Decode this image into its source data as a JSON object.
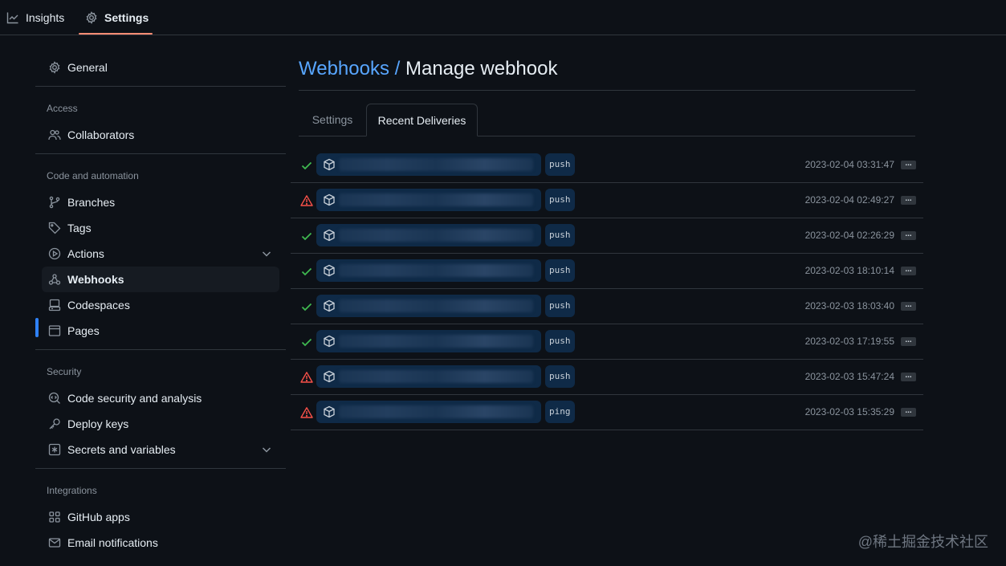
{
  "nav": {
    "tabs": [
      {
        "label": "Insights",
        "icon": "graph-icon"
      },
      {
        "label": "Settings",
        "icon": "gear-icon",
        "active": true
      }
    ],
    "accent": "#fd8c73"
  },
  "sidebar": {
    "general": "General",
    "sections": [
      {
        "heading": "Access",
        "items": [
          "Collaborators"
        ]
      },
      {
        "heading": "Code and automation",
        "items": [
          "Branches",
          "Tags",
          "Actions",
          "Webhooks",
          "Codespaces",
          "Pages"
        ]
      },
      {
        "heading": "Security",
        "items": [
          "Code security and analysis",
          "Deploy keys",
          "Secrets and variables"
        ]
      },
      {
        "heading": "Integrations",
        "items": [
          "GitHub apps",
          "Email notifications"
        ]
      }
    ],
    "active_item": "Webhooks"
  },
  "main": {
    "breadcrumb": "Webhooks",
    "separator": " / ",
    "title": "Manage webhook",
    "tabs": [
      "Settings",
      "Recent Deliveries"
    ],
    "active_tab": "Recent Deliveries"
  },
  "deliveries": [
    {
      "status": "success",
      "event": "push",
      "time": "2023-02-04 03:31:47"
    },
    {
      "status": "failure",
      "event": "push",
      "time": "2023-02-04 02:49:27"
    },
    {
      "status": "success",
      "event": "push",
      "time": "2023-02-04 02:26:29"
    },
    {
      "status": "success",
      "event": "push",
      "time": "2023-02-03 18:10:14"
    },
    {
      "status": "success",
      "event": "push",
      "time": "2023-02-03 18:03:40"
    },
    {
      "status": "success",
      "event": "push",
      "time": "2023-02-03 17:19:55"
    },
    {
      "status": "failure",
      "event": "push",
      "time": "2023-02-03 15:47:24"
    },
    {
      "status": "failure",
      "event": "ping",
      "time": "2023-02-03 15:35:29"
    }
  ],
  "more_label": "...",
  "watermark": "@稀土掘金技术社区",
  "colors": {
    "success": "#3fb950",
    "failure": "#f85149",
    "link": "#58a6ff",
    "active_bar": "#2f81f7"
  }
}
